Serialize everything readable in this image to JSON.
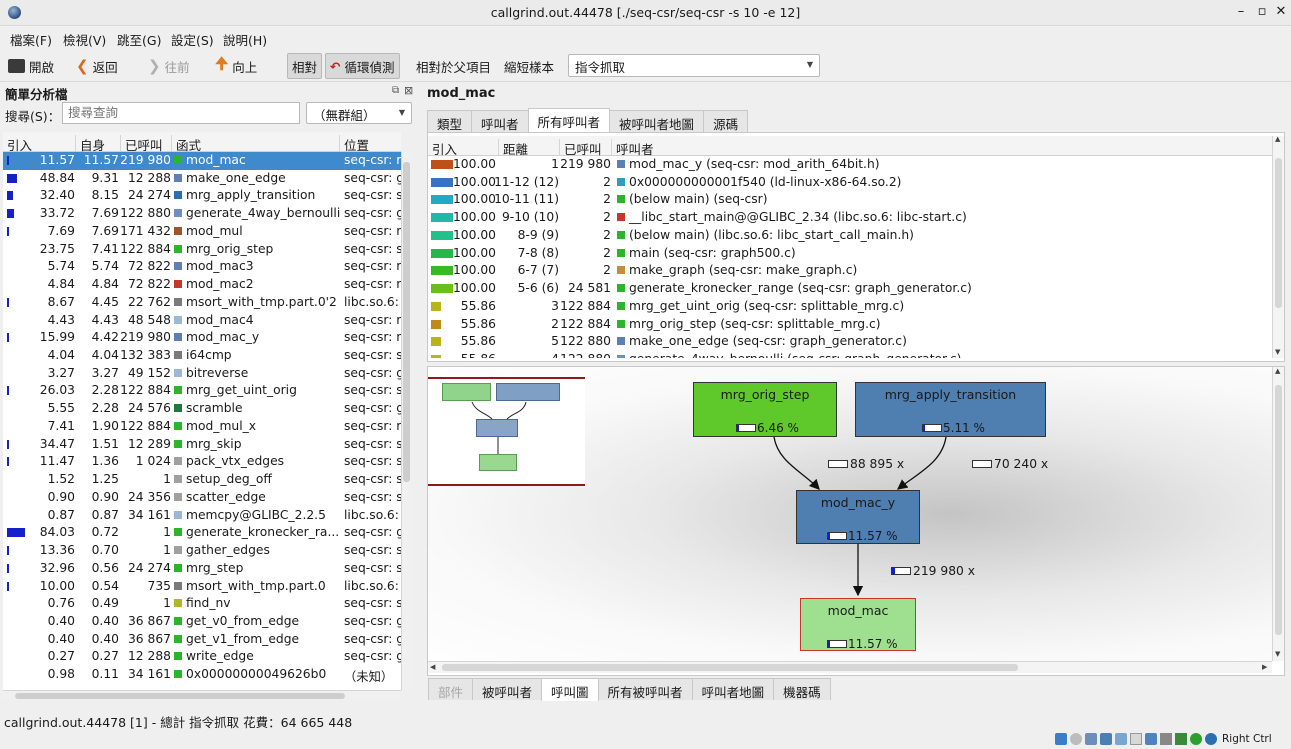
{
  "window": {
    "title": "callgrind.out.44478 [./seq-csr/seq-csr -s 10 -e 12]",
    "minimize": "–",
    "maximize": "▫",
    "close": "✕"
  },
  "menu": [
    "檔案(F)",
    "檢視(V)",
    "跳至(G)",
    "設定(S)",
    "說明(H)"
  ],
  "toolbar": {
    "open": "開啟",
    "back": "返回",
    "forward": "往前",
    "up": "向上",
    "relative": "相對",
    "cycle_detect": "循環偵測",
    "relative_parent": "相對於父項目",
    "shorten_templates": "縮短樣本",
    "event_type": "指令抓取"
  },
  "left": {
    "panel_title": "簡單分析檔",
    "search_label": "搜尋(S)：",
    "search_placeholder": "搜尋查詢",
    "group": "（無群組）",
    "headers": [
      "引入",
      "自身",
      "已呼叫",
      "函式",
      "位置"
    ],
    "rows": [
      {
        "incl": "11.57",
        "self": "11.57",
        "called": "219 980",
        "func": "mod_mac",
        "loc": "seq-csr: m",
        "color": "#2bb52b",
        "bar": 0.02
      },
      {
        "incl": "48.84",
        "self": "9.31",
        "called": "12 288",
        "func": "make_one_edge",
        "loc": "seq-csr: gr",
        "color": "#5c7fb4",
        "bar": 0.16
      },
      {
        "incl": "32.40",
        "self": "8.15",
        "called": "24 274",
        "func": "mrg_apply_transition",
        "loc": "seq-csr: sp",
        "color": "#2b6fb0",
        "bar": 0.1
      },
      {
        "incl": "33.72",
        "self": "7.69",
        "called": "122 880",
        "func": "generate_4way_bernoulli",
        "loc": "seq-csr: gr",
        "color": "#6d8dc3",
        "bar": 0.11
      },
      {
        "incl": "7.69",
        "self": "7.69",
        "called": "171 432",
        "func": "mod_mul",
        "loc": "seq-csr: m",
        "color": "#a0522d",
        "bar": 0.015
      },
      {
        "incl": "23.75",
        "self": "7.41",
        "called": "122 884",
        "func": "mrg_orig_step",
        "loc": "seq-csr: sp",
        "color": "#2bb52b",
        "bar": 0
      },
      {
        "incl": "5.74",
        "self": "5.74",
        "called": "72 822",
        "func": "mod_mac3",
        "loc": "seq-csr: m",
        "color": "#5c7fb4",
        "bar": 0
      },
      {
        "incl": "4.84",
        "self": "4.84",
        "called": "72 822",
        "func": "mod_mac2",
        "loc": "seq-csr: m",
        "color": "#c0392b",
        "bar": 0
      },
      {
        "incl": "8.67",
        "self": "4.45",
        "called": "22 762",
        "func": "msort_with_tmp.part.0'2",
        "loc": "libc.so.6: c",
        "color": "#7a7a7a",
        "bar": 0.01
      },
      {
        "incl": "4.43",
        "self": "4.43",
        "called": "48 548",
        "func": "mod_mac4",
        "loc": "seq-csr: m",
        "color": "#9bb9d6",
        "bar": 0
      },
      {
        "incl": "15.99",
        "self": "4.42",
        "called": "219 980",
        "func": "mod_mac_y",
        "loc": "seq-csr: m",
        "color": "#5c7fb4",
        "bar": 0.015
      },
      {
        "incl": "4.04",
        "self": "4.04",
        "called": "132 383",
        "func": "i64cmp",
        "loc": "seq-csr: se",
        "color": "#7a7a7a",
        "bar": 0
      },
      {
        "incl": "3.27",
        "self": "3.27",
        "called": "49 152",
        "func": "bitreverse",
        "loc": "seq-csr: gr",
        "color": "#9bb9d6",
        "bar": 0
      },
      {
        "incl": "26.03",
        "self": "2.28",
        "called": "122 884",
        "func": "mrg_get_uint_orig",
        "loc": "seq-csr: sp",
        "color": "#2bb52b",
        "bar": 0.02
      },
      {
        "incl": "5.55",
        "self": "2.28",
        "called": "24 576",
        "func": "scramble",
        "loc": "seq-csr: gr",
        "color": "#1f7a3c",
        "bar": 0
      },
      {
        "incl": "7.41",
        "self": "1.90",
        "called": "122 884",
        "func": "mod_mul_x",
        "loc": "seq-csr: m",
        "color": "#2bb52b",
        "bar": 0
      },
      {
        "incl": "34.47",
        "self": "1.51",
        "called": "12 289",
        "func": "mrg_skip",
        "loc": "seq-csr: sp",
        "color": "#2bb52b",
        "bar": 0.02
      },
      {
        "incl": "11.47",
        "self": "1.36",
        "called": "1 024",
        "func": "pack_vtx_edges",
        "loc": "seq-csr: se",
        "color": "#a0a0a0",
        "bar": 0.01
      },
      {
        "incl": "1.52",
        "self": "1.25",
        "called": "1",
        "func": "setup_deg_off",
        "loc": "seq-csr: se",
        "color": "#a0a0a0",
        "bar": 0
      },
      {
        "incl": "0.90",
        "self": "0.90",
        "called": "24 356",
        "func": "scatter_edge",
        "loc": "seq-csr: se",
        "color": "#a0a0a0",
        "bar": 0
      },
      {
        "incl": "0.87",
        "self": "0.87",
        "called": "34 161",
        "func": "memcpy@GLIBC_2.2.5",
        "loc": "libc.so.6: n",
        "color": "#9bb9d6",
        "bar": 0
      },
      {
        "incl": "84.03",
        "self": "0.72",
        "called": "1",
        "func": "generate_kronecker_ra...",
        "loc": "seq-csr: gr",
        "color": "#2bb52b",
        "bar": 0.3
      },
      {
        "incl": "13.36",
        "self": "0.70",
        "called": "1",
        "func": "gather_edges",
        "loc": "seq-csr: se",
        "color": "#a0a0a0",
        "bar": 0.01
      },
      {
        "incl": "32.96",
        "self": "0.56",
        "called": "24 274",
        "func": "mrg_step",
        "loc": "seq-csr: sp",
        "color": "#2bb52b",
        "bar": 0.02
      },
      {
        "incl": "10.00",
        "self": "0.54",
        "called": "735",
        "func": "msort_with_tmp.part.0",
        "loc": "libc.so.6: c",
        "color": "#7a7a7a",
        "bar": 0.01
      },
      {
        "incl": "0.76",
        "self": "0.49",
        "called": "1",
        "func": "find_nv",
        "loc": "seq-csr: se",
        "color": "#b5b52b",
        "bar": 0
      },
      {
        "incl": "0.40",
        "self": "0.40",
        "called": "36 867",
        "func": "get_v0_from_edge",
        "loc": "seq-csr: gr",
        "color": "#2bb52b",
        "bar": 0
      },
      {
        "incl": "0.40",
        "self": "0.40",
        "called": "36 867",
        "func": "get_v1_from_edge",
        "loc": "seq-csr: gr",
        "color": "#2bb52b",
        "bar": 0
      },
      {
        "incl": "0.27",
        "self": "0.27",
        "called": "12 288",
        "func": "write_edge",
        "loc": "seq-csr: gr",
        "color": "#2bb52b",
        "bar": 0
      },
      {
        "incl": "0.98",
        "self": "0.11",
        "called": "34 161",
        "func": "0x00000000049626b0",
        "loc": "（未知）",
        "color": "#2bb52b",
        "bar": 0
      }
    ]
  },
  "status": "callgrind.out.44478 [1] - 總計 指令抓取 花費：64 665 448",
  "right": {
    "function_title": "mod_mac",
    "top_tabs": [
      "類型",
      "呼叫者",
      "所有呼叫者",
      "被呼叫者地圖",
      "源碼"
    ],
    "headers": [
      "引入",
      "距離",
      "已呼叫",
      "呼叫者"
    ],
    "rows": [
      {
        "incl": "100.00",
        "dist": "1",
        "called": "219 980",
        "caller": "mod_mac_y (seq-csr: mod_arith_64bit.h)",
        "color": "#5c7fb4",
        "grad": "#c0501a"
      },
      {
        "incl": "100.00",
        "dist": "11-12 (12)",
        "called": "2",
        "caller": "0x000000000001f540 (ld-linux-x86-64.so.2)",
        "color": "#2b9fc0",
        "grad": "#3a72c4"
      },
      {
        "incl": "100.00",
        "dist": "10-11 (11)",
        "called": "2",
        "caller": "(below main) (seq-csr)",
        "color": "#2bb52b",
        "grad": "#22aac4"
      },
      {
        "incl": "100.00",
        "dist": "9-10 (10)",
        "called": "2",
        "caller": "__libc_start_main@@GLIBC_2.34 (libc.so.6: libc-start.c)",
        "color": "#c0392b",
        "grad": "#22b8a8"
      },
      {
        "incl": "100.00",
        "dist": "8-9 (9)",
        "called": "2",
        "caller": "(below main) (libc.so.6: libc_start_call_main.h)",
        "color": "#2bb52b",
        "grad": "#22c08a"
      },
      {
        "incl": "100.00",
        "dist": "7-8 (8)",
        "called": "2",
        "caller": "main (seq-csr: graph500.c)",
        "color": "#2bb52b",
        "grad": "#22b84a"
      },
      {
        "incl": "100.00",
        "dist": "6-7 (7)",
        "called": "2",
        "caller": "make_graph (seq-csr: make_graph.c)",
        "color": "#c0903b",
        "grad": "#3aba22"
      },
      {
        "incl": "100.00",
        "dist": "5-6 (6)",
        "called": "24 581",
        "caller": "generate_kronecker_range (seq-csr: graph_generator.c)",
        "color": "#2bb52b",
        "grad": "#6cbf1a"
      },
      {
        "incl": "55.86",
        "dist": "3",
        "called": "122 884",
        "caller": "mrg_get_uint_orig (seq-csr: splittable_mrg.c)",
        "color": "#2bb52b",
        "grad": "#b8b41a",
        "short": true
      },
      {
        "incl": "55.86",
        "dist": "2",
        "called": "122 884",
        "caller": "mrg_orig_step (seq-csr: splittable_mrg.c)",
        "color": "#2bb52b",
        "grad": "#c08a1a",
        "short": true
      },
      {
        "incl": "55.86",
        "dist": "5",
        "called": "122 880",
        "caller": "make_one_edge (seq-csr: graph_generator.c)",
        "color": "#5c7fb4",
        "grad": "#b8b41a",
        "short": true
      },
      {
        "incl": "55.86",
        "dist": "4",
        "called": "122 880",
        "caller": "generate_4way_bernoulli (seq-csr: graph_generator.c)",
        "color": "#6d8dc3",
        "grad": "#b8b41a",
        "short": true
      }
    ],
    "graph": {
      "nodes": {
        "orig_step": {
          "name": "mrg_orig_step",
          "pct": "6.46 %",
          "frac": 0.06
        },
        "apply": {
          "name": "mrg_apply_transition",
          "pct": "5.11 %",
          "frac": 0.05
        },
        "mac_y": {
          "name": "mod_mac_y",
          "pct": "11.57 %",
          "frac": 0.12
        },
        "mac": {
          "name": "mod_mac",
          "pct": "11.57 %",
          "frac": 0.12
        }
      },
      "edges": {
        "e1": "88 895 x",
        "e2": "70 240 x",
        "e3": "219 980 x"
      }
    },
    "bottom_tabs": [
      "部件",
      "被呼叫者",
      "呼叫圖",
      "所有被呼叫者",
      "呼叫者地圖",
      "機器碼"
    ]
  },
  "tray": {
    "keyboard": "Right Ctrl"
  }
}
